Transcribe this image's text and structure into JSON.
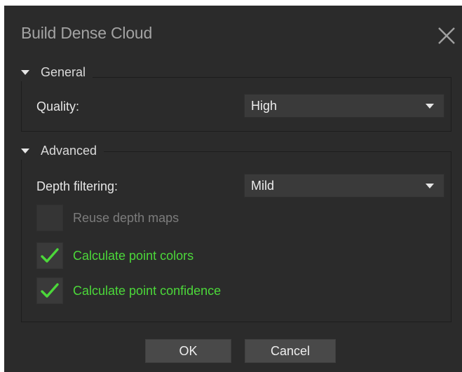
{
  "dialog": {
    "title": "Build Dense Cloud",
    "close_icon": "close-icon"
  },
  "general": {
    "header": "General",
    "quality_label": "Quality:",
    "quality_value": "High"
  },
  "advanced": {
    "header": "Advanced",
    "depth_filtering_label": "Depth filtering:",
    "depth_filtering_value": "Mild",
    "checkboxes": [
      {
        "label": "Reuse depth maps",
        "checked": false,
        "enabled": false
      },
      {
        "label": "Calculate point colors",
        "checked": true,
        "enabled": true
      },
      {
        "label": "Calculate point confidence",
        "checked": true,
        "enabled": true
      }
    ]
  },
  "buttons": {
    "ok": "OK",
    "cancel": "Cancel"
  },
  "colors": {
    "background": "#2b2b2b",
    "checked_accent": "#4cd83a",
    "disabled_text": "#7c7c7c"
  }
}
